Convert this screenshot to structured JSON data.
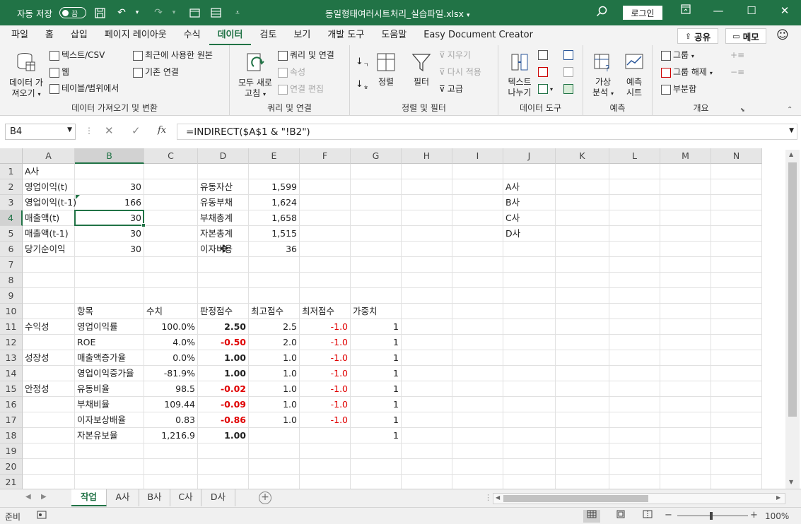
{
  "titlebar": {
    "autosave_label": "자동 저장",
    "autosave_state": "끔",
    "filename": "동일형태여러시트처리_실습파일.xlsx",
    "login_label": "로그인"
  },
  "menu": {
    "items": [
      "파일",
      "홈",
      "삽입",
      "페이지 레이아웃",
      "수식",
      "데이터",
      "검토",
      "보기",
      "개발 도구",
      "도움말",
      "Easy Document Creator"
    ],
    "active_index": 5,
    "share_label": "공유",
    "memo_label": "메모"
  },
  "ribbon": {
    "get_data": {
      "big_button": "데이터 가져오기",
      "big_button_l1": "데이터 가",
      "big_button_l2": "져오기",
      "text_csv": "텍스트/CSV",
      "web": "웹",
      "table_range": "테이블/범위에서",
      "recent_sources": "최근에 사용한 원본",
      "existing_conn": "기존 연결",
      "group_label": "데이터 가져오기 및 변환"
    },
    "queries": {
      "refresh_all_l1": "모두 새로",
      "refresh_all_l2": "고침",
      "queries_conn": "쿼리 및 연결",
      "properties": "속성",
      "edit_links": "연결 편집",
      "group_label": "쿼리 및 연결"
    },
    "sort_filter": {
      "sort": "정렬",
      "filter": "필터",
      "clear": "지우기",
      "reapply": "다시 적용",
      "advanced": "고급",
      "group_label": "정렬 및 필터"
    },
    "data_tools": {
      "text_to_columns_l1": "텍스트",
      "text_to_columns_l2": "나누기",
      "group_label": "데이터 도구"
    },
    "forecast": {
      "whatif_l1": "가상",
      "whatif_l2": "분석",
      "forecast_l1": "예측",
      "forecast_l2": "시트",
      "group_label": "예측"
    },
    "outline": {
      "group": "그룹",
      "ungroup": "그룹 해제",
      "subtotal": "부분합",
      "group_label": "개요"
    }
  },
  "formula_bar": {
    "name_box": "B4",
    "formula": "=INDIRECT($A$1 & \"!B2\")"
  },
  "columns": [
    "A",
    "B",
    "C",
    "D",
    "E",
    "F",
    "G",
    "H",
    "I",
    "J",
    "K",
    "L",
    "M",
    "N"
  ],
  "rows": [
    "1",
    "2",
    "3",
    "4",
    "5",
    "6",
    "7",
    "8",
    "9",
    "10",
    "11",
    "12",
    "13",
    "14",
    "15",
    "16",
    "17",
    "18",
    "19",
    "20",
    "21"
  ],
  "cells": {
    "A1": "A사",
    "A2": "영업이익(t)",
    "B2": "30",
    "D2": "유동자산",
    "E2": "1,599",
    "J2": "A사",
    "A3": "영업이익(t-1)",
    "B3": "166",
    "D3": "유동부채",
    "E3": "1,624",
    "J3": "B사",
    "A4": "매출액(t)",
    "B4": "30",
    "D4": "부채총계",
    "E4": "1,658",
    "J4": "C사",
    "A5": "매출액(t-1)",
    "B5": "30",
    "D5": "자본총계",
    "E5": "1,515",
    "J5": "D사",
    "A6": "당기순이익",
    "B6": "30",
    "D6": "이자비용",
    "E6": "36",
    "B10": "항목",
    "C10": "수치",
    "D10": "판정점수",
    "E10": "최고점수",
    "F10": "최저점수",
    "G10": "가중치",
    "A11": "수익성",
    "B11": "영업이익률",
    "C11": "100.0%",
    "D11": "2.50",
    "E11": "2.5",
    "F11": "-1.0",
    "G11": "1",
    "B12": "ROE",
    "C12": "4.0%",
    "D12": "-0.50",
    "E12": "2.0",
    "F12": "-1.0",
    "G12": "1",
    "A13": "성장성",
    "B13": "매출액증가율",
    "C13": "0.0%",
    "D13": "1.00",
    "E13": "1.0",
    "F13": "-1.0",
    "G13": "1",
    "B14": "영업이익증가율",
    "C14": "-81.9%",
    "D14": "1.00",
    "E14": "1.0",
    "F14": "-1.0",
    "G14": "1",
    "A15": "안정성",
    "B15": "유동비율",
    "C15": "98.5",
    "D15": "-0.02",
    "E15": "1.0",
    "F15": "-1.0",
    "G15": "1",
    "B16": "부채비율",
    "C16": "109.44",
    "D16": "-0.09",
    "E16": "1.0",
    "F16": "-1.0",
    "G16": "1",
    "B17": "이자보상배율",
    "C17": "0.83",
    "D17": "-0.86",
    "E17": "1.0",
    "F17": "-1.0",
    "G17": "1",
    "B18": "자본유보율",
    "C18": "1,216.9",
    "D18": "1.00",
    "G18": "1"
  },
  "sheet_tabs": [
    "작업",
    "A사",
    "B사",
    "C사",
    "D사"
  ],
  "active_sheet": "작업",
  "status": {
    "ready": "준비",
    "zoom": "100%"
  }
}
